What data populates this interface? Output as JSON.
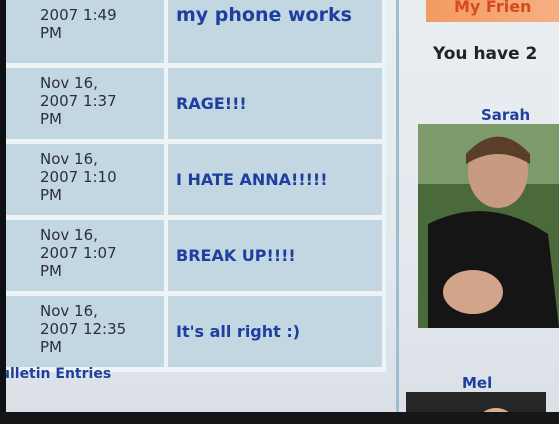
{
  "bulletins": [
    {
      "date_line1": "2007 1:49",
      "date_line2": "PM",
      "date_line3": "",
      "title": "my phone works"
    },
    {
      "date_line1": "Nov 16,",
      "date_line2": "2007 1:37",
      "date_line3": "PM",
      "title": "RAGE!!!"
    },
    {
      "date_line1": "Nov 16,",
      "date_line2": "2007 1:10",
      "date_line3": "PM",
      "title": "I HATE ANNA!!!!!"
    },
    {
      "date_line1": "Nov 16,",
      "date_line2": "2007 1:07",
      "date_line3": "PM",
      "title": "BREAK UP!!!!"
    },
    {
      "date_line1": "Nov 16,",
      "date_line2": "2007 12:35",
      "date_line3": "PM",
      "title": "It's all right :)"
    }
  ],
  "footer_link": "ulletin Entries",
  "friends": {
    "header": "My Frien",
    "count_text": "You have 2",
    "items": [
      {
        "name": "Sarah"
      },
      {
        "name": "Mel"
      }
    ]
  }
}
